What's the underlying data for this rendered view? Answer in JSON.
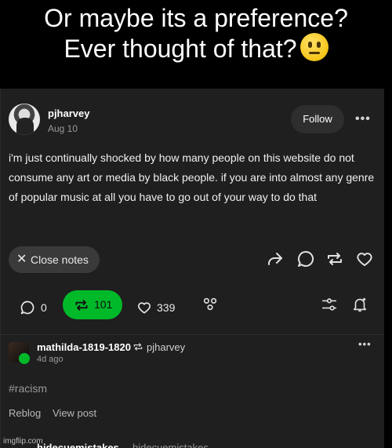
{
  "caption": {
    "line1": "Or maybe its a preference?",
    "line2": "Ever thought of that?",
    "emoji": "neutral-face-emoji"
  },
  "post": {
    "username": "pjharvey",
    "date": "Aug 10",
    "follow_label": "Follow",
    "body": "i'm just continually shocked by how many people on this website do not consume any art or media by black people. if you are into almost any genre of popular music at all you have to go out of your way to do that",
    "close_notes_label": "Close notes"
  },
  "stats": {
    "replies": "0",
    "reblogs": "101",
    "likes": "339"
  },
  "note": {
    "username": "mathilda-1819-1820",
    "source": "pjharvey",
    "time": "4d ago",
    "tag": "#racism",
    "reblog_label": "Reblog",
    "view_post_label": "View post"
  },
  "next_note": {
    "username": "hidecuemistakes",
    "source": "hidecuemistakes"
  },
  "watermark": "imgflip.com",
  "colors": {
    "background": "#000000",
    "card": "#1f1f1f",
    "accent_green": "#00b929"
  }
}
